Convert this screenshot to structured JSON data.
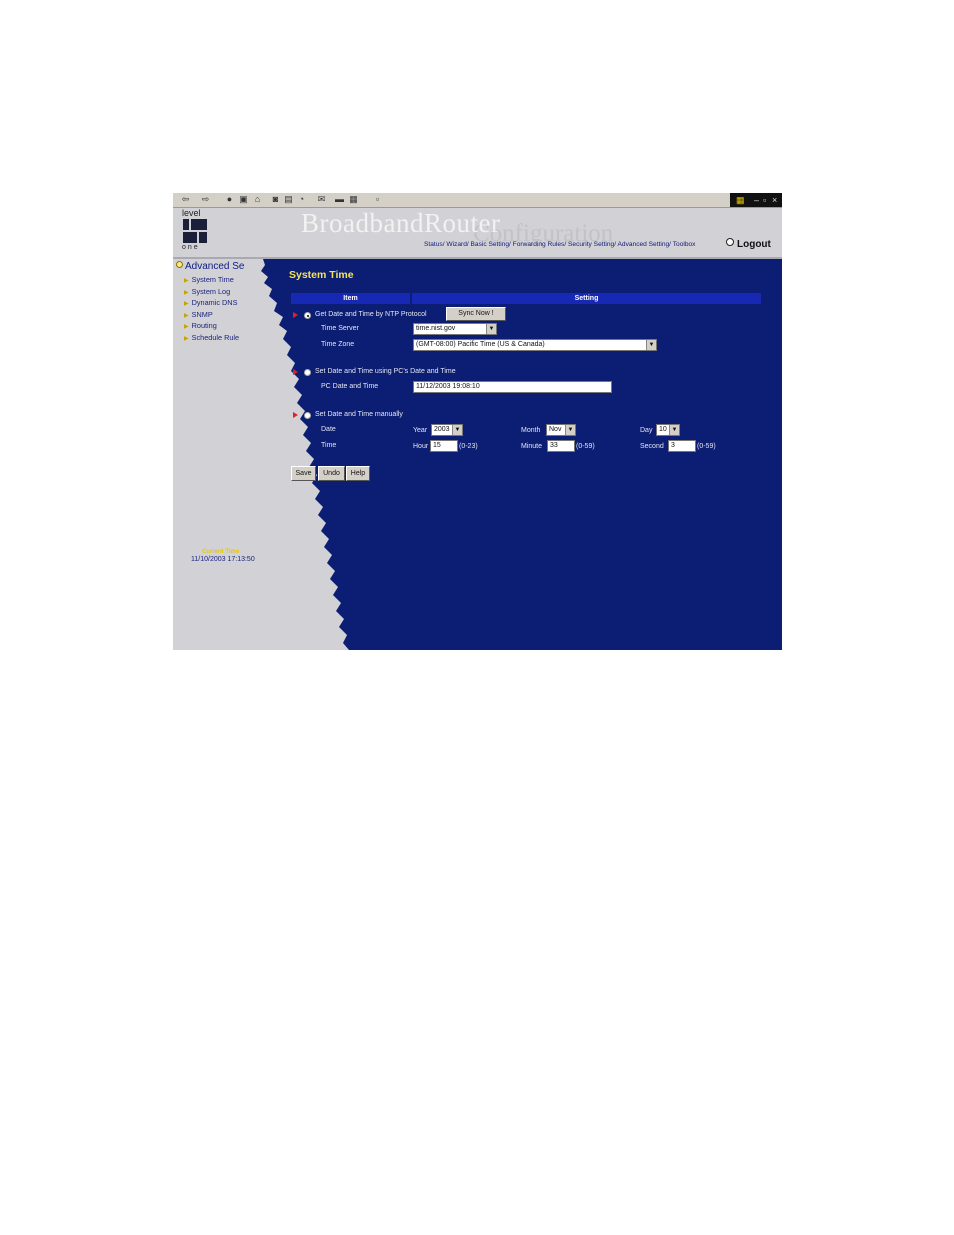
{
  "header": {
    "brand": "BroadbandRouter",
    "brand_sub": "Configuration",
    "nav": "Status/ Wizard/ Basic Setting/ Forwarding Rules/ Security Setting/ Advanced Setting/ Toolbox",
    "logout": "Logout",
    "logo_top": "level",
    "logo_bottom": "one"
  },
  "sidebar": {
    "title": "Advanced Se",
    "items": [
      {
        "label": "System Time"
      },
      {
        "label": "System Log"
      },
      {
        "label": "Dynamic DNS"
      },
      {
        "label": "SNMP"
      },
      {
        "label": "Routing"
      },
      {
        "label": "Schedule Rule"
      }
    ],
    "current_time_label": "Current Time",
    "current_time": "11/10/2003 17:13:50"
  },
  "main": {
    "title": "System Time",
    "col_item": "Item",
    "col_setting": "Setting",
    "ntp": {
      "label": "Get Date and Time by NTP Protocol",
      "sync_button": "Sync Now !",
      "time_server_label": "Time Server",
      "time_server_value": "time.nist.gov",
      "time_zone_label": "Time Zone",
      "time_zone_value": "(GMT-08:00) Pacific Time (US & Canada)"
    },
    "pc": {
      "label": "Set Date and Time using PC's Date and Time",
      "pc_time_label": "PC Date and Time",
      "pc_time_value": "11/12/2003 19:08:10"
    },
    "manual": {
      "label": "Set Date and Time manually",
      "date_label": "Date",
      "time_label": "Time",
      "year_label": "Year",
      "year_value": "2003",
      "month_label": "Month",
      "month_value": "Nov",
      "day_label": "Day",
      "day_value": "10",
      "hour_label": "Hour",
      "hour_value": "15",
      "hour_range": "(0-23)",
      "minute_label": "Minute",
      "minute_value": "33",
      "minute_range": "(0-59)",
      "second_label": "Second",
      "second_value": "3",
      "second_range": "(0-59)"
    },
    "buttons": {
      "save": "Save",
      "undo": "Undo",
      "help": "Help"
    }
  },
  "colors": {
    "content_bg": "#0b1e74",
    "sidebar_bg": "#d2d2d6",
    "title_yellow": "#f7e35a",
    "table_header": "#1628b4",
    "pointer_red": "#e3202a"
  }
}
